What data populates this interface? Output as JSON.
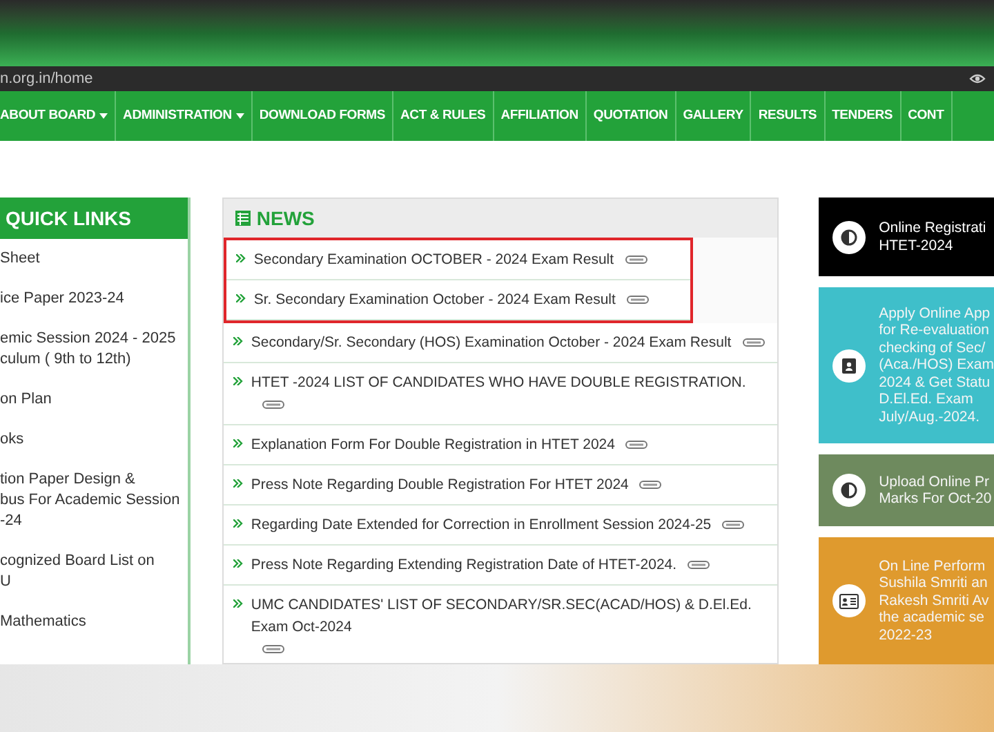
{
  "address_bar": {
    "url": "n.org.in/home"
  },
  "nav": [
    {
      "label": "ABOUT BOARD",
      "dropdown": true
    },
    {
      "label": "ADMINISTRATION",
      "dropdown": true
    },
    {
      "label": "DOWNLOAD FORMS",
      "dropdown": false
    },
    {
      "label": "ACT & RULES",
      "dropdown": false
    },
    {
      "label": "AFFILIATION",
      "dropdown": false
    },
    {
      "label": "QUOTATION",
      "dropdown": false
    },
    {
      "label": "GALLERY",
      "dropdown": false
    },
    {
      "label": "RESULTS",
      "dropdown": false
    },
    {
      "label": "TENDERS",
      "dropdown": false
    },
    {
      "label": "CONT",
      "dropdown": false
    }
  ],
  "quick_links": {
    "title": "QUICK LINKS",
    "items": [
      {
        "lines": [
          "Sheet"
        ]
      },
      {
        "lines": [
          "ice Paper 2023-24"
        ]
      },
      {
        "lines": [
          "emic Session 2024 - 2025",
          "culum ( 9th to 12th)"
        ]
      },
      {
        "lines": [
          "on Plan"
        ]
      },
      {
        "lines": [
          "oks"
        ]
      },
      {
        "lines": [
          "tion Paper Design &",
          "bus For Academic Session",
          "-24"
        ]
      },
      {
        "lines": [
          "cognized Board List on",
          "U"
        ]
      },
      {
        "lines": [
          "Mathematics"
        ]
      }
    ]
  },
  "news": {
    "title": "NEWS",
    "items": [
      {
        "text": "Secondary Examination OCTOBER - 2024 Exam Result",
        "highlighted": true
      },
      {
        "text": "Sr. Secondary Examination October - 2024 Exam Result",
        "highlighted": true
      },
      {
        "text": "Secondary/Sr. Secondary (HOS) Examination October - 2024 Exam Result",
        "highlighted": false
      },
      {
        "text": "HTET -2024 LIST OF CANDIDATES WHO HAVE DOUBLE REGISTRATION.",
        "highlighted": false
      },
      {
        "text": "Explanation Form For Double Registration in HTET 2024",
        "highlighted": false
      },
      {
        "text": "Press Note Regarding Double Registration For HTET 2024",
        "highlighted": false
      },
      {
        "text": "Regarding Date Extended for Correction in Enrollment Session 2024-25",
        "highlighted": false
      },
      {
        "text": "Press Note Regarding Extending Registration Date of HTET-2024.",
        "highlighted": false
      },
      {
        "text": "UMC CANDIDATES' LIST OF SECONDARY/SR.SEC(ACAD/HOS) & D.El.Ed. Exam Oct-2024",
        "highlighted": false
      }
    ]
  },
  "notice_cards": [
    {
      "color": "#000000",
      "kind": "half-circle",
      "lines": [
        "Online Registrati",
        "HTET-2024"
      ]
    },
    {
      "color": "#3fbfca",
      "kind": "contact-book",
      "lines": [
        "Apply Online App",
        "for Re-evaluation",
        "checking of Sec/",
        "(Aca./HOS) Exam",
        "2024 & Get Statu",
        "D.El.Ed. Exam",
        "July/Aug.-2024."
      ]
    },
    {
      "color": "#6e8a5e",
      "kind": "half-circle",
      "lines": [
        "Upload Online Pr",
        "Marks For Oct-20"
      ]
    },
    {
      "color": "#df9a2e",
      "kind": "id-card",
      "lines": [
        "On Line Perform",
        "Sushila Smriti an",
        "Rakesh Smriti Av",
        "the academic se",
        "2022-23"
      ]
    }
  ]
}
